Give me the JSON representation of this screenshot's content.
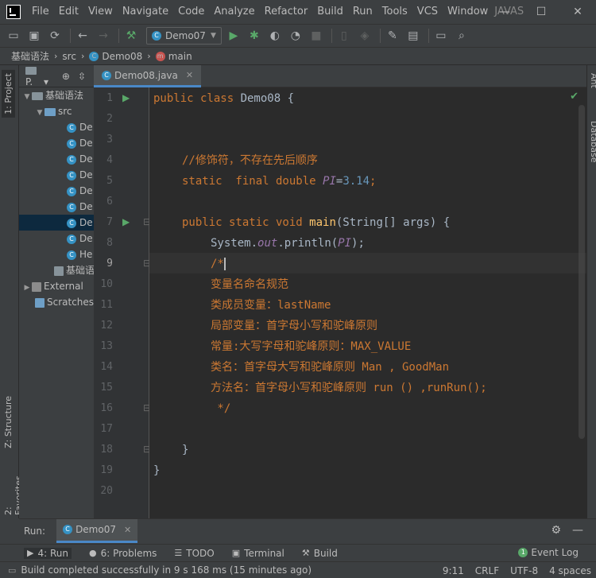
{
  "menu": [
    "File",
    "Edit",
    "View",
    "Navigate",
    "Code",
    "Analyze",
    "Refactor",
    "Build",
    "Run",
    "Tools",
    "VCS",
    "Window"
  ],
  "project_name": "JAVAS",
  "window_buttons": {
    "minimize": "—",
    "maximize": "☐",
    "close": "✕"
  },
  "toolbar": {
    "run_config": "Demo07"
  },
  "breadcrumb": [
    "基础语法",
    "src",
    "Demo08",
    "main"
  ],
  "left_strip": {
    "project": "1: Project",
    "structure": "Z: Structure",
    "favorites": "2: Favorites"
  },
  "right_strip": {
    "ant": "Ant",
    "database": "Database"
  },
  "project_panel": {
    "header": "P.",
    "root": "基础语法",
    "src": "src",
    "files": [
      "De",
      "De",
      "De",
      "De",
      "De",
      "De",
      "De",
      "De",
      "He"
    ],
    "selected_index": 6,
    "iml": "基础语",
    "external": "External",
    "scratches": "Scratches"
  },
  "editor": {
    "tab": "Demo08.java",
    "line_numbers": [
      "1",
      "2",
      "3",
      "4",
      "5",
      "6",
      "7",
      "8",
      "9",
      "10",
      "11",
      "12",
      "13",
      "14",
      "15",
      "16",
      "17",
      "18",
      "19",
      "20"
    ],
    "lines": {
      "l1a": "public class ",
      "l1b": "Demo08 {",
      "l4": "//修饰符，不存在先后顺序",
      "l5a": "static  final double ",
      "l5b": "PI",
      "l5c": "=",
      "l5d": "3.14",
      ";": ";",
      "l7a": "public static void ",
      "l7b": "main",
      "l7c": "(String[] args) {",
      "l8a": "System.",
      "l8b": "out",
      "l8c": ".println(",
      "l8d": "PI",
      "l8e": ");",
      "l9": "/*",
      "l10": "变量名命名规范",
      "l11": "类成员变量：lastName",
      "l12": "局部变量：首字母小写和驼峰原则",
      "l13": "常量:大写字母和驼峰原则：MAX_VALUE",
      "l14": "类名：首字母大写和驼峰原则 Man , GoodMan",
      "l15": "方法名：首字母小写和驼峰原则 run () ,runRun();",
      "l16": " */",
      "l18": "}",
      "l19": "}"
    }
  },
  "run_bar": {
    "label": "Run:",
    "tab": "Demo07"
  },
  "bottom_tabs": [
    {
      "icon": "▶",
      "label": "4: Run"
    },
    {
      "icon": "●",
      "label": "6: Problems"
    },
    {
      "icon": "☰",
      "label": "TODO"
    },
    {
      "icon": "▣",
      "label": "Terminal"
    },
    {
      "icon": "⚒",
      "label": "Build"
    }
  ],
  "event_log": "Event Log",
  "status": {
    "message": "Build completed successfully in 9 s 168 ms (15 minutes ago)",
    "position": "9:11",
    "line_sep": "CRLF",
    "encoding": "UTF-8",
    "indent": "4 spaces"
  }
}
